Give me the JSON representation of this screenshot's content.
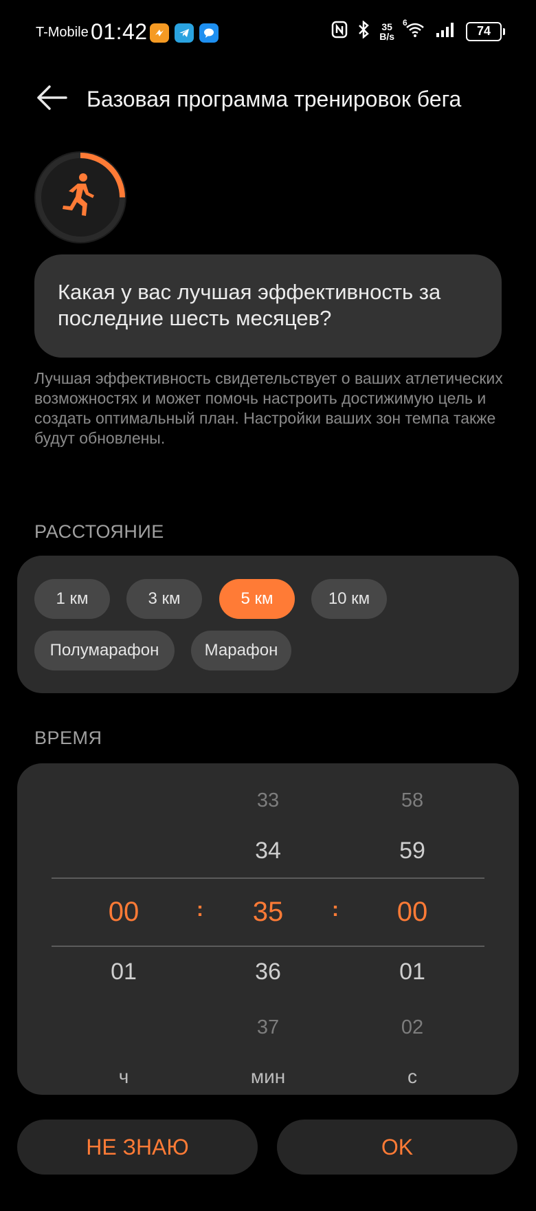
{
  "status_bar": {
    "carrier": "T-Mobile",
    "time": "01:42",
    "net_speed_value": "35",
    "net_speed_unit": "B/s",
    "wifi_label": "6",
    "battery": "74",
    "icons": [
      "orange-app-icon",
      "telegram-icon",
      "messages-icon",
      "nfc-icon",
      "bluetooth-icon",
      "wifi-icon",
      "signal-icon",
      "battery-icon"
    ]
  },
  "header": {
    "title": "Базовая программа тренировок бега",
    "back_icon": "back-arrow-icon"
  },
  "progress": {
    "icon": "runner-icon",
    "fraction": 0.25,
    "accent": "#ff7b36"
  },
  "question": {
    "text": "Какая у вас лучшая эффективность за последние шесть месяцев?",
    "description": "Лучшая эффективность свидетельствует о ваших атлетических возможностях и может помочь настроить достижимую цель и создать оптимальный план. Настройки ваших зон темпа также будут обновлены."
  },
  "distance": {
    "label": "РАССТОЯНИЕ",
    "options": [
      "1 км",
      "3 км",
      "5 км",
      "10 км",
      "Полумарафон",
      "Марафон"
    ],
    "selected": "5 км"
  },
  "time": {
    "label": "ВРЕМЯ",
    "hours": {
      "above": "",
      "selected": "00",
      "below1": "01",
      "below2": "",
      "unit": "ч"
    },
    "minutes": {
      "above2": "33",
      "above1": "34",
      "selected": "35",
      "below1": "36",
      "below2": "37",
      "unit": "мин"
    },
    "seconds": {
      "above2": "58",
      "above1": "59",
      "selected": "00",
      "below1": "01",
      "below2": "02",
      "unit": "с"
    },
    "separator": ":"
  },
  "buttons": {
    "dont_know": "НЕ ЗНАЮ",
    "ok": "OK"
  },
  "colors": {
    "background": "#000000",
    "accent": "#ff7b36",
    "card": "#2c2c2c"
  }
}
